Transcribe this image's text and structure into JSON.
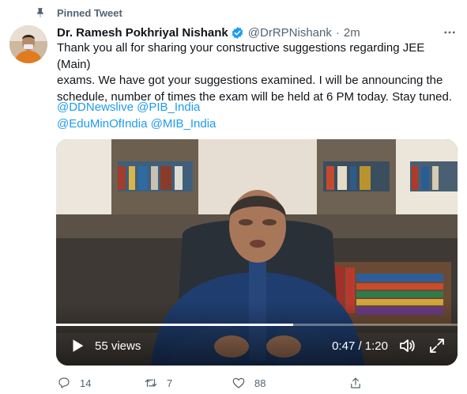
{
  "pinned": {
    "label": "Pinned Tweet",
    "icon": "pin-icon"
  },
  "author": {
    "name": "Dr. Ramesh Pokhriyal Nishank",
    "handle": "@DrRPNishank",
    "separator": "·",
    "time": "2m",
    "verified_icon": "verified-badge-icon",
    "verified_color": "#1d9bf0"
  },
  "tweet": {
    "text": "Thank you all for sharing your constructive suggestions regarding JEE (Main)\nexams. We have got your suggestions examined. I will be announcing the\nschedule, number of times the exam will be held  at 6 PM today. Stay tuned.",
    "mentions": [
      "@DDNewslive",
      "@PIB_India",
      "@EduMinOfIndia",
      "@MIB_India"
    ],
    "link_color": "#1d9bf0"
  },
  "video": {
    "views": "55 views",
    "timecode": "0:47 / 1:20",
    "progress_fraction": 0.59,
    "play_icon": "play-icon",
    "volume_icon": "volume-icon",
    "fullscreen_icon": "fullscreen-icon"
  },
  "actions": {
    "reply_count": "14",
    "retweet_count": "7",
    "like_count": "88"
  }
}
